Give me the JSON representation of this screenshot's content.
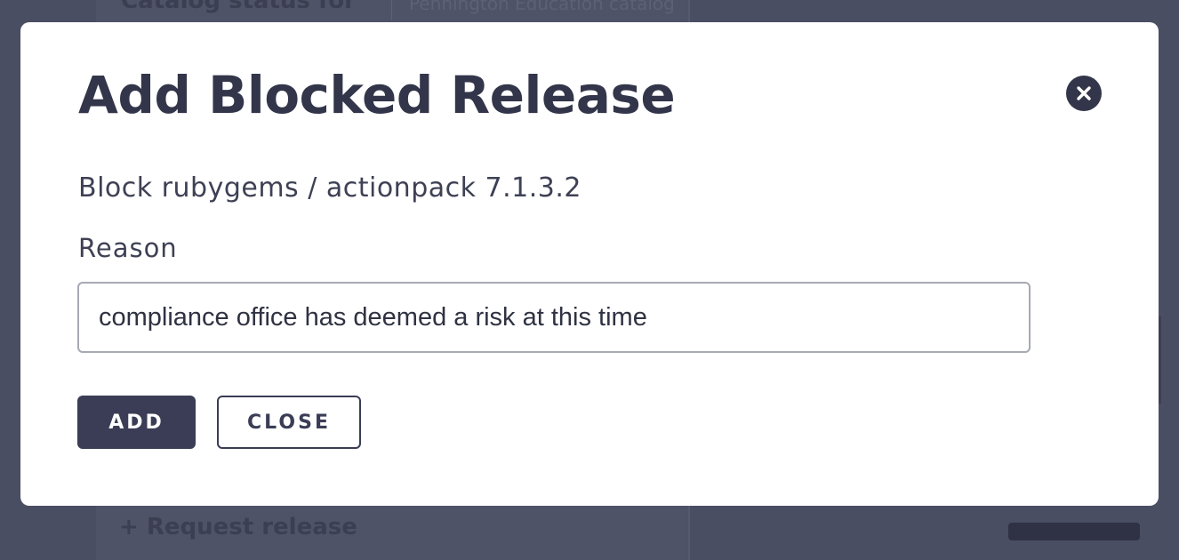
{
  "background": {
    "heading": "Catalog status for",
    "subheading": "Pennington Education catalog",
    "request_link": "+ Request release"
  },
  "modal": {
    "title": "Add Blocked Release",
    "subtitle": "Block rubygems / actionpack 7.1.3.2",
    "reason_label": "Reason",
    "reason_value": "compliance office has deemed a risk at this time",
    "add_label": "ADD",
    "close_label": "CLOSE",
    "close_icon": "close-icon"
  },
  "colors": {
    "primary": "#3a3d55",
    "overlay": "#4a4e63",
    "text": "#33364a"
  }
}
